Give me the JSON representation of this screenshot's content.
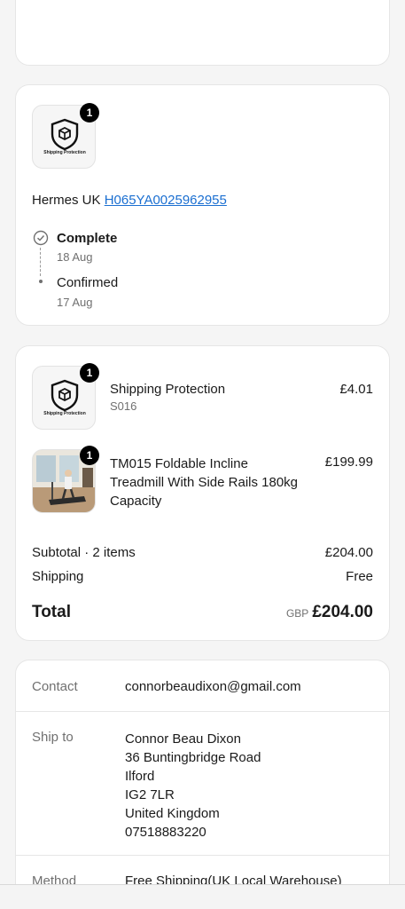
{
  "shipment": {
    "item_count": "1",
    "product_icon_text": "Shipping Protection",
    "carrier": "Hermes UK",
    "tracking_number": "H065YA0025962955",
    "timeline": [
      {
        "status": "Complete",
        "date": "18 Aug"
      },
      {
        "status": "Confirmed",
        "date": "17 Aug"
      }
    ]
  },
  "order": {
    "items": [
      {
        "qty": "1",
        "name": "Shipping Protection",
        "sku": "S016",
        "price": "£4.01"
      },
      {
        "qty": "1",
        "name_line1": "TM015 Foldable Incline",
        "name_line2": "Treadmill With Side Rails 180kg",
        "name_line3": "Capacity",
        "price": "£199.99"
      }
    ],
    "subtotal_label": "Subtotal · 2 items",
    "subtotal_value": "£204.00",
    "shipping_label": "Shipping",
    "shipping_value": "Free",
    "total_label": "Total",
    "currency": "GBP",
    "total_value": "£204.00"
  },
  "details": {
    "contact_label": "Contact",
    "contact_value": "connorbeaudixon@gmail.com",
    "ship_to_label": "Ship to",
    "address": [
      "Connor Beau Dixon",
      "36 Buntingbridge Road",
      "Ilford",
      "IG2 7LR",
      "United Kingdom",
      "07518883220"
    ],
    "method_label": "Method",
    "method_value": "Free Shipping(UK Local Warehouse)"
  }
}
